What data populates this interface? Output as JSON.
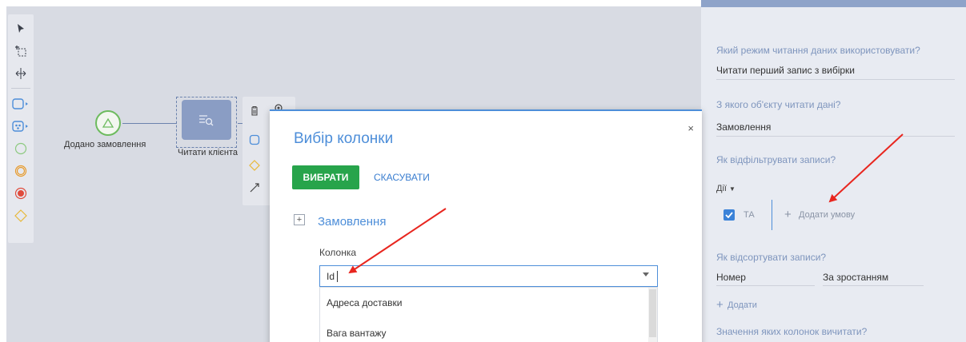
{
  "palette": {
    "tools": [
      "pointer-icon",
      "lasso-icon",
      "space-icon"
    ],
    "elements": [
      "task-icon",
      "subprocess-icon",
      "start-event-icon",
      "intermediate-event-icon",
      "end-event-icon",
      "gateway-icon"
    ]
  },
  "diagram": {
    "start_label": "Додано замовлення",
    "task_label": "Читати клієнта"
  },
  "dialog": {
    "title": "Вибір колонки",
    "close": "×",
    "select_button": "ВИБРАТИ",
    "cancel_button": "СКАСУВАТИ",
    "expand_symbol": "+",
    "group_title": "Замовлення",
    "column_label": "Колонка",
    "column_value": "Id",
    "dropdown_options": [
      "Адреса доставки",
      "Вага вантажу"
    ]
  },
  "right_panel": {
    "read_mode_question": "Який режим читання даних використовувати?",
    "read_mode_value": "Читати перший запис з вибірки",
    "object_question": "З якого об'єкту читати дані?",
    "object_value": "Замовлення",
    "filter_question": "Як відфільтрувати записи?",
    "actions_label": "Дії",
    "and_label": "ТА",
    "add_condition": "Додати умову",
    "sort_question": "Як відсортувати записи?",
    "sort_column": "Номер",
    "sort_direction": "За зростанням",
    "add_label": "Додати",
    "columns_question": "Значення яких колонок вичитати?"
  },
  "colors": {
    "accent": "#4d8ed9",
    "select_button": "#27a44b",
    "annotation_arrow": "#e8261f",
    "start_event": "#6dbb5e",
    "task_fill": "#8a9dc4"
  }
}
